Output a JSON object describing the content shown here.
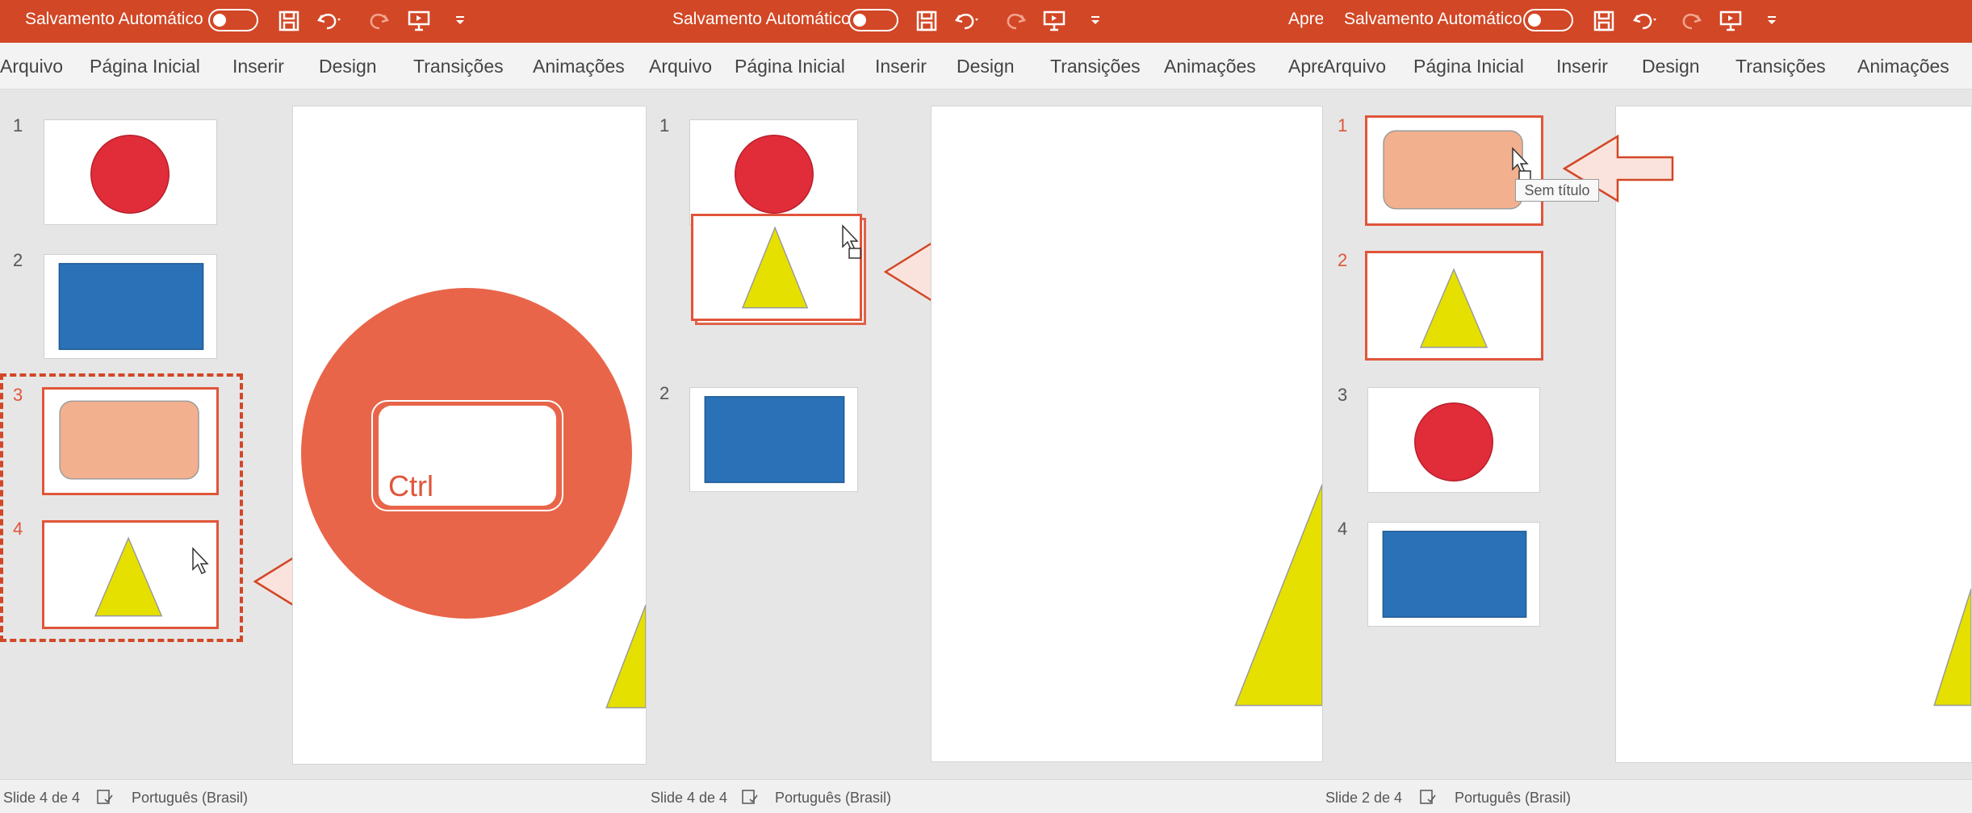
{
  "colors": {
    "accent": "#d24726",
    "selection": "#e0553a",
    "circle": "#e12c3a",
    "rectangle": "#2a71b8",
    "rounded_rectangle": "#f2b08f",
    "triangle": "#e6e000",
    "ctrl_badge": "#e8654a"
  },
  "panels": [
    {
      "titlebar": {
        "autosave_label": "Salvamento Automático"
      },
      "menu": [
        "Arquivo",
        "Página Inicial",
        "Inserir",
        "Design",
        "Transições",
        "Animações"
      ],
      "thumbnails": [
        {
          "number": "1",
          "shape": "circle"
        },
        {
          "number": "2",
          "shape": "rectangle"
        },
        {
          "number": "3",
          "shape": "rounded-rectangle",
          "selected": true
        },
        {
          "number": "4",
          "shape": "triangle",
          "selected": true
        }
      ],
      "overlay": {
        "key_label": "Ctrl"
      },
      "status": {
        "slide_info": "Slide 4 de 4",
        "language": "Português (Brasil)"
      }
    },
    {
      "titlebar": {
        "autosave_label": "Salvamento Automático",
        "cut_text": "Apre"
      },
      "menu": [
        "Arquivo",
        "Página Inicial",
        "Inserir",
        "Design",
        "Transições",
        "Animações",
        "Apre"
      ],
      "thumbnails": [
        {
          "number": "1",
          "shape": "circle"
        },
        {
          "number": "2",
          "shape": "triangle",
          "dragging": true
        },
        {
          "number": "2",
          "shape": "rectangle"
        }
      ],
      "status": {
        "slide_info": "Slide 4 de 4",
        "language": "Português (Brasil)"
      }
    },
    {
      "titlebar": {
        "autosave_label": "Salvamento Automático"
      },
      "menu": [
        "Arquivo",
        "Página Inicial",
        "Inserir",
        "Design",
        "Transições",
        "Animações"
      ],
      "thumbnails": [
        {
          "number": "1",
          "shape": "rounded-rectangle",
          "selected": true
        },
        {
          "number": "2",
          "shape": "triangle",
          "selected": true
        },
        {
          "number": "3",
          "shape": "circle"
        },
        {
          "number": "4",
          "shape": "rectangle"
        }
      ],
      "tooltip": "Sem título",
      "status": {
        "slide_info": "Slide 2 de 4",
        "language": "Português (Brasil)"
      }
    }
  ],
  "icons": [
    "save-icon",
    "undo-icon",
    "redo-icon",
    "present-icon",
    "customize-icon",
    "proofing-icon",
    "cursor-icon",
    "move-cursor-icon"
  ]
}
